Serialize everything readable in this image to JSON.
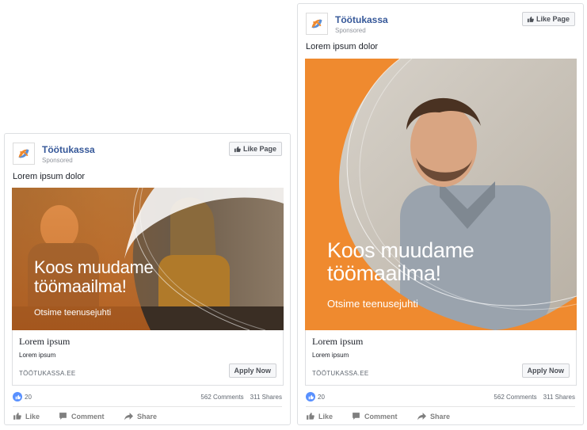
{
  "ad": {
    "page_name": "Töötukassa",
    "sponsored": "Sponsored",
    "like_page": "Like Page",
    "body_text": "Lorem ipsum dolor",
    "headline_line1": "Koos muudame",
    "headline_line2": "töömaailma!",
    "subheadline": "Otsime teenusejuhti",
    "link_title": "Lorem ipsum",
    "link_description": "Lorem ipsum",
    "link_domain": "TÖÖTUKASSA.EE",
    "cta": "Apply Now",
    "reactions_count": "20",
    "comments": "562 Comments",
    "shares": "311 Shares",
    "actions": {
      "like": "Like",
      "comment": "Comment",
      "share": "Share"
    }
  },
  "colors": {
    "brand_orange": "#ef8a2f",
    "link_blue": "#365899",
    "reaction_blue": "#5890ff"
  },
  "icons": [
    "toötukassa-logo",
    "thumbs-up-icon",
    "comment-icon",
    "share-icon"
  ]
}
